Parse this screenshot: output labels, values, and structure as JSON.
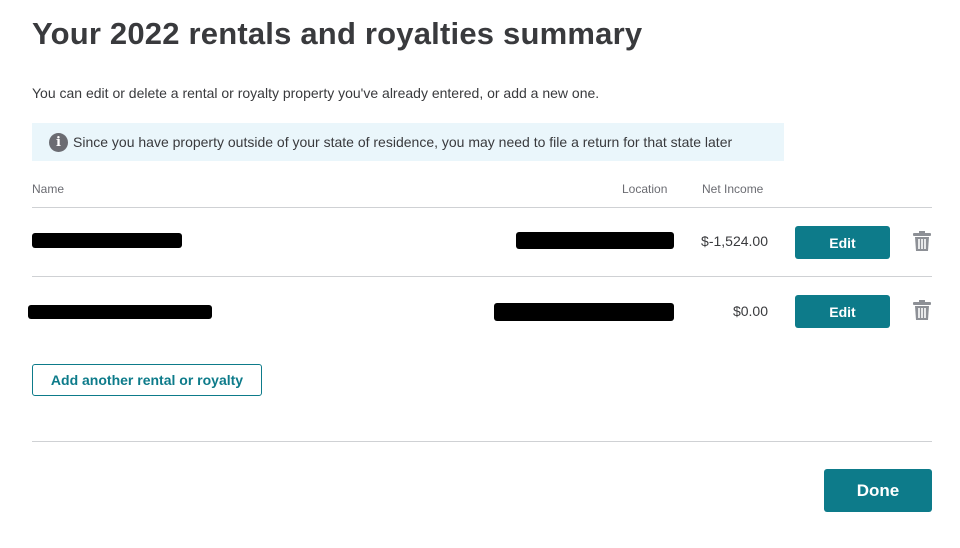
{
  "page": {
    "title": "Your 2022 rentals and royalties summary",
    "subtitle": "You can edit or delete a rental or royalty property you've already entered, or add a new one."
  },
  "notice": {
    "icon": "info-icon",
    "text": "Since you have property outside of your state of residence, you may need to file a return for that state later"
  },
  "table": {
    "headers": {
      "name": "Name",
      "location": "Location",
      "net_income": "Net Income"
    },
    "rows": [
      {
        "name": "[redacted]",
        "location": "[redacted]",
        "net_income": "$-1,524.00",
        "edit_label": "Edit",
        "delete_icon": "trash-icon"
      },
      {
        "name": "[redacted]",
        "location": "[redacted]",
        "net_income": "$0.00",
        "edit_label": "Edit",
        "delete_icon": "trash-icon"
      }
    ]
  },
  "actions": {
    "add_label": "Add another rental or royalty",
    "done_label": "Done"
  },
  "colors": {
    "accent": "#0d7b8a",
    "notice_bg": "#eaf6fb",
    "text": "#393a3d"
  }
}
